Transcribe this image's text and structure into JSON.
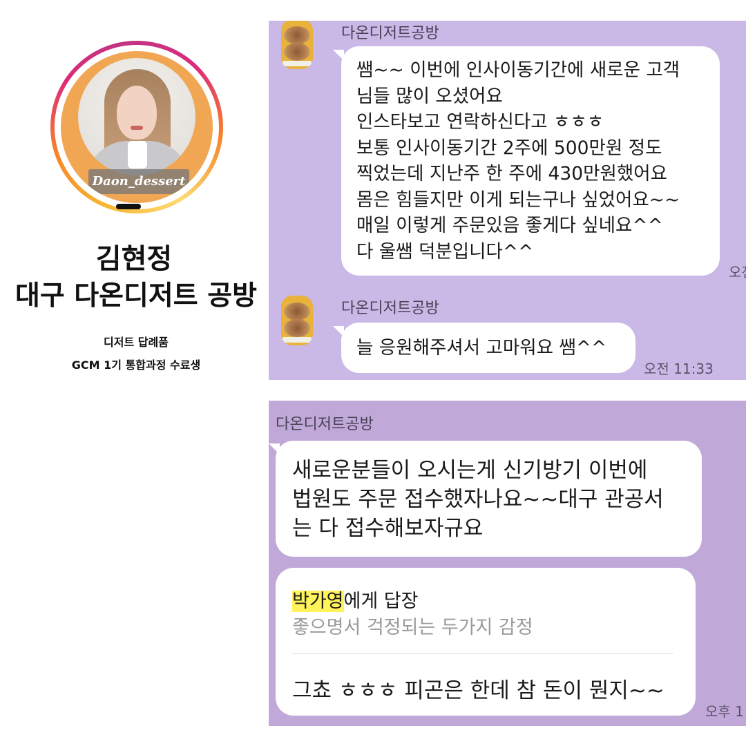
{
  "profile": {
    "handle": "Daon_dessert",
    "name": "김현정",
    "business": "대구 다온디저트 공방",
    "tagline": "디저트 답례품",
    "course": "GCM 1기 통합과정 수료생"
  },
  "chat1": {
    "messages": [
      {
        "sender": "다온디저트공방",
        "text": "쌤~~  이번에 인사이동기간에 새로운 고객\n님들 많이 오셨어요\n인스타보고 연락하신다고 ㅎㅎㅎ\n보통 인사이동기간 2주에 500만원 정도\n찍었는데 지난주 한 주에 430만원했어요\n몸은 힘들지만 이게 되는구나 싶었어요~~\n매일 이렇게 주문있음 좋게다 싶네요^^\n다 울쌤 덕분입니다^^",
        "time": "오전"
      },
      {
        "sender": "다온디저트공방",
        "text": "늘 응원해주셔서 고마워요 쌤^^",
        "time": "오전 11:33"
      }
    ]
  },
  "chat2": {
    "sender": "다온디저트공방",
    "message": "새로운분들이  오시는게 신기방기 이번에\n법원도 주문 접수했자나요~~대구 관공서\n는 다  접수해보자규요",
    "reply": {
      "target_name": "박가영",
      "target_suffix": "에게 답장",
      "quoted": "좋으명서 걱정되는 두가지 감정",
      "text": "그쵸 ㅎㅎㅎ 피곤은 한데 참 돈이 뭔지~~"
    },
    "time": "오후 1"
  },
  "colors": {
    "chat1_bg": "#cab8e6",
    "chat2_bg": "#c0a8d8",
    "bubble": "#ffffff",
    "highlight": "#fff35c",
    "avatar_bg": "#f0a653"
  }
}
